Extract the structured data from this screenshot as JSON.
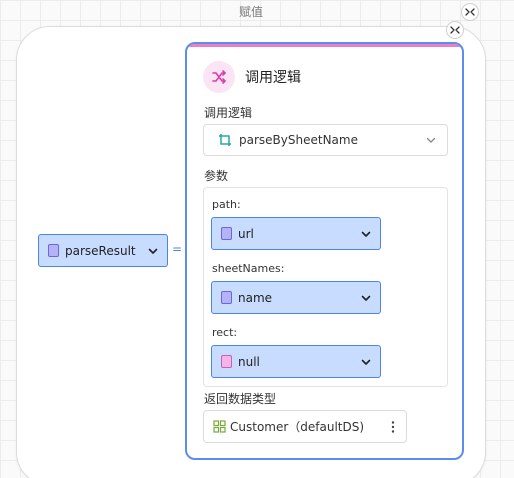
{
  "header": {
    "title": "赋值"
  },
  "assignment": {
    "left_variable": "parseResult",
    "operator": "="
  },
  "call_logic": {
    "card_title": "调用逻辑",
    "method_label": "调用逻辑",
    "method_value": "parseBySheetName",
    "params_label": "参数",
    "params": [
      {
        "name": "path:",
        "value": "url",
        "var_color": "purple"
      },
      {
        "name": "sheetNames:",
        "value": "name",
        "var_color": "purple"
      },
      {
        "name": "rect:",
        "value": "null",
        "var_color": "pink"
      }
    ],
    "return_label": "返回数据类型",
    "return_value": "Customer（defaultDS)"
  },
  "icons": {
    "collapse": "collapse-icon",
    "shuffle": "shuffle-icon",
    "method": "method-icon",
    "entity": "entity-grid-icon",
    "chevron": "chevron-down-icon",
    "kebab": "more-vert-icon"
  },
  "colors": {
    "accent": "#4a86e8",
    "card_border": "#5b8def",
    "card_top": "#ea7fc3",
    "variable_fill": "#c7dcfe",
    "var_purple": "#b6b2f7",
    "var_pink": "#f2b5e6"
  }
}
